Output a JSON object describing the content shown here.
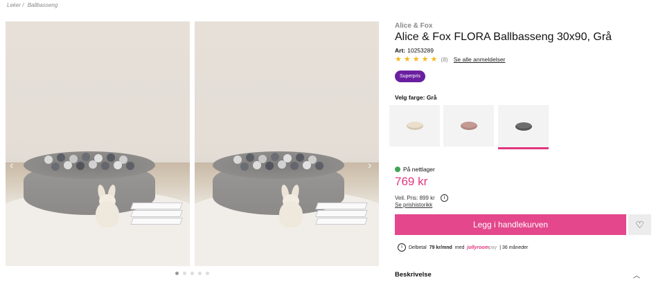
{
  "breadcrumb": {
    "items": [
      "Leker /",
      "Ballbasseng"
    ]
  },
  "gallery": {
    "images": [
      {
        "alt": "ball-pool-photo-1"
      },
      {
        "alt": "ball-pool-photo-2"
      }
    ],
    "prev_icon": "chevron-left-icon",
    "next_icon": "chevron-right-icon",
    "dots_total": 5,
    "dots_active": 1
  },
  "product": {
    "brand": "Alice & Fox",
    "title": "Alice & Fox FLORA Ballbasseng 30x90, Grå",
    "art_label": "Art:",
    "art_number": "10253289",
    "rating": {
      "stars": 5,
      "count": "(8)",
      "reviews_link": "Se alle anmeldelser"
    },
    "badge": "Superpris",
    "color_label": "Velg farge: Grå",
    "swatches": [
      {
        "name": "beige",
        "color": "#e9dfcc",
        "selected": false
      },
      {
        "name": "rosa",
        "color": "#c49a93",
        "selected": false
      },
      {
        "name": "grå",
        "color": "#6e6e6e",
        "selected": true
      }
    ],
    "stock": "På nettlager",
    "price": "769 kr",
    "ref_price": "Veil. Pris: 899 kr",
    "price_history": "Se prishistorikk",
    "cart_button": "Legg i handlekurven",
    "installment": {
      "prefix": "Delbetal",
      "amount": "79 kr/mnd",
      "with": "med",
      "provider": "jollyroom",
      "provider_suffix": "pay",
      "term": "| 36 måneder"
    },
    "description_label": "Beskrivelse"
  },
  "colors": {
    "accent": "#e4478c",
    "badge": "#6a1fa0",
    "stock": "#3ea556",
    "star": "#f3b81b"
  }
}
